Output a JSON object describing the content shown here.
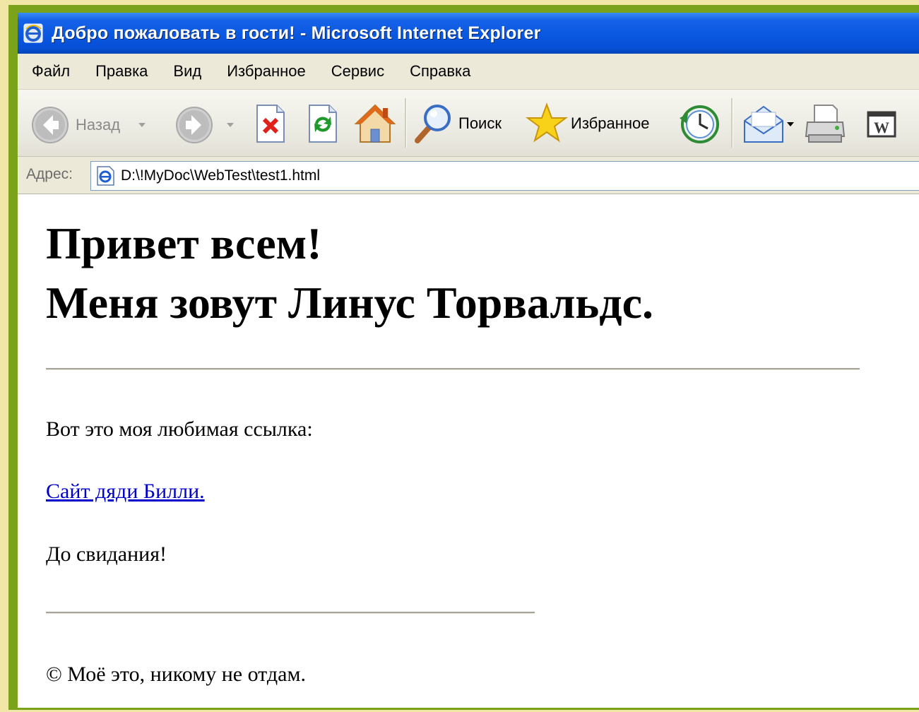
{
  "window": {
    "title": "Добро пожаловать в гости! - Microsoft Internet Explorer"
  },
  "menu": {
    "items": [
      "Файл",
      "Правка",
      "Вид",
      "Избранное",
      "Сервис",
      "Справка"
    ]
  },
  "toolbar": {
    "back_label": "Назад",
    "search_label": "Поиск",
    "favorites_label": "Избранное"
  },
  "address": {
    "label": "Адрес:",
    "value": "D:\\!MyDoc\\WebTest\\test1.html"
  },
  "page": {
    "heading_line1": "Привет всем!",
    "heading_line2": "Меня зовут Линус Торвальдс.",
    "fav_link_intro": "Вот это моя любимая ссылка:",
    "link_text": "Сайт дяди Билли.",
    "goodbye": "До свидания!",
    "footer": "© Моё это, никому не отдам."
  },
  "colors": {
    "frame_green": "#7aa21b",
    "slide_background": "#f2e6a6",
    "titlebar_blue": "#0a57e0",
    "link_blue": "#0000cc"
  }
}
